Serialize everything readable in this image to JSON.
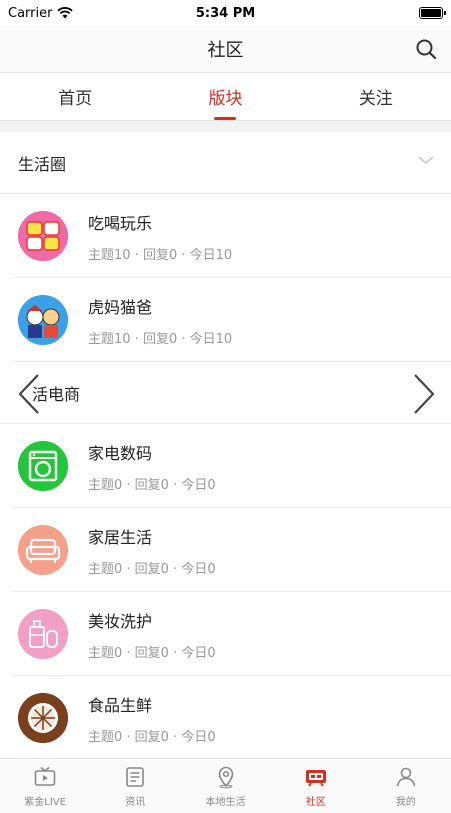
{
  "status_bar": {
    "carrier": "Carrier",
    "time": "5:34 PM"
  },
  "nav": {
    "title": "社区",
    "search_icon": "search-icon"
  },
  "tabs": [
    {
      "label": "首页",
      "active": false
    },
    {
      "label": "版块",
      "active": true
    },
    {
      "label": "关注",
      "active": false
    }
  ],
  "sections": [
    {
      "title": "生活圈",
      "boards": [
        {
          "name": "吃喝玩乐",
          "stats": "主题10 · 回复0 · 今日10",
          "icon": "food-fun-icon"
        },
        {
          "name": "虎妈猫爸",
          "stats": "主题10 · 回复0 · 今日10",
          "icon": "parents-icon"
        }
      ]
    },
    {
      "title": "活电商",
      "boards": [
        {
          "name": "家电数码",
          "stats": "主题0 · 回复0 · 今日0",
          "icon": "washing-machine-icon"
        },
        {
          "name": "家居生活",
          "stats": "主题0 · 回复0 · 今日0",
          "icon": "sofa-icon"
        },
        {
          "name": "美妆洗护",
          "stats": "主题0 · 回复0 · 今日0",
          "icon": "cosmetics-icon"
        },
        {
          "name": "食品生鲜",
          "stats": "主题0 · 回复0 · 今日0",
          "icon": "citrus-icon"
        }
      ]
    }
  ],
  "tab_bar": [
    {
      "label": "紫金LIVE",
      "icon": "tv-icon",
      "active": false
    },
    {
      "label": "资讯",
      "icon": "news-icon",
      "active": false
    },
    {
      "label": "本地生活",
      "icon": "location-icon",
      "active": false
    },
    {
      "label": "社区",
      "icon": "community-icon",
      "active": true
    },
    {
      "label": "我的",
      "icon": "profile-icon",
      "active": false
    }
  ],
  "colors": {
    "accent": "#d32f1f",
    "muted": "#999999",
    "divider": "#ececec"
  }
}
